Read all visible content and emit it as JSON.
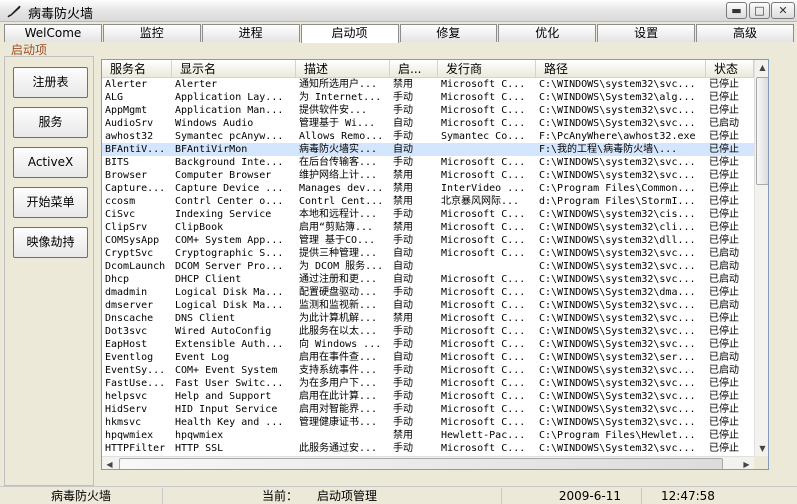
{
  "window": {
    "title": "病毒防火墙"
  },
  "tabs": [
    "WelCome",
    "监控",
    "进程",
    "启动项",
    "修复",
    "优化",
    "设置",
    "高级"
  ],
  "active_tab": 3,
  "section_label": "启动项",
  "side_buttons": [
    "注册表",
    "服务",
    "ActiveX",
    "开始菜单",
    "映像劫持"
  ],
  "columns": [
    "服务名",
    "显示名",
    "描述",
    "启...",
    "发行商",
    "路径",
    "状态"
  ],
  "selected_row": 5,
  "rows": [
    [
      "Alerter",
      "Alerter",
      "通知所选用户...",
      "禁用",
      "Microsoft C...",
      "C:\\WINDOWS\\system32\\svc...",
      "已停止"
    ],
    [
      "ALG",
      "Application Lay...",
      "为 Internet...",
      "手动",
      "Microsoft C...",
      "C:\\WINDOWS\\System32\\alg...",
      "已停止"
    ],
    [
      "AppMgmt",
      "Application Man...",
      "提供软件安...",
      "手动",
      "Microsoft C...",
      "C:\\WINDOWS\\system32\\svc...",
      "已停止"
    ],
    [
      "AudioSrv",
      "Windows Audio",
      "管理基于 Wi...",
      "自动",
      "Microsoft C...",
      "C:\\WINDOWS\\System32\\svc...",
      "已启动"
    ],
    [
      "awhost32",
      "Symantec pcAnyw...",
      "Allows Remo...",
      "手动",
      "Symantec Co...",
      "F:\\PcAnyWhere\\awhost32.exe",
      "已停止"
    ],
    [
      "BFAntiV...",
      "BFAntiVirMon",
      "病毒防火墙实...",
      "自动",
      "",
      "F:\\我的工程\\病毒防火墙\\...",
      "已停止"
    ],
    [
      "BITS",
      "Background Inte...",
      "在后台传输客...",
      "手动",
      "Microsoft C...",
      "C:\\WINDOWS\\system32\\svc...",
      "已停止"
    ],
    [
      "Browser",
      "Computer Browser",
      "维护网络上计...",
      "禁用",
      "Microsoft C...",
      "C:\\WINDOWS\\system32\\svc...",
      "已停止"
    ],
    [
      "Capture...",
      "Capture Device ...",
      "Manages dev...",
      "禁用",
      "InterVideo ...",
      "C:\\Program Files\\Common...",
      "已停止"
    ],
    [
      "ccosm",
      "Contrl Center o...",
      "Contrl Cent...",
      "禁用",
      "北京暴风网际...",
      "d:\\Program Files\\StormI...",
      "已停止"
    ],
    [
      "CiSvc",
      "Indexing Service",
      "本地和远程计...",
      "手动",
      "Microsoft C...",
      "C:\\WINDOWS\\system32\\cis...",
      "已停止"
    ],
    [
      "ClipSrv",
      "ClipBook",
      "启用“剪贴簿...",
      "禁用",
      "Microsoft C...",
      "C:\\WINDOWS\\system32\\cli...",
      "已停止"
    ],
    [
      "COMSysApp",
      "COM+ System App...",
      "管理 基于CO...",
      "手动",
      "Microsoft C...",
      "C:\\WINDOWS\\system32\\dll...",
      "已停止"
    ],
    [
      "CryptSvc",
      "Cryptographic S...",
      "提供三种管理...",
      "自动",
      "Microsoft C...",
      "C:\\WINDOWS\\system32\\svc...",
      "已启动"
    ],
    [
      "DcomLaunch",
      "DCOM Server Pro...",
      "为 DCOM 服务...",
      "自动",
      "",
      "C:\\WINDOWS\\system32\\svc...",
      "已启动"
    ],
    [
      "Dhcp",
      "DHCP Client",
      "通过注册和更...",
      "自动",
      "Microsoft C...",
      "C:\\WINDOWS\\system32\\svc...",
      "已启动"
    ],
    [
      "dmadmin",
      "Logical Disk Ma...",
      "配置硬盘驱动...",
      "手动",
      "Microsoft C...",
      "C:\\WINDOWS\\System32\\dma...",
      "已停止"
    ],
    [
      "dmserver",
      "Logical Disk Ma...",
      "监测和监视新...",
      "自动",
      "Microsoft C...",
      "C:\\WINDOWS\\System32\\svc...",
      "已启动"
    ],
    [
      "Dnscache",
      "DNS Client",
      "为此计算机解...",
      "禁用",
      "Microsoft C...",
      "C:\\WINDOWS\\system32\\svc...",
      "已停止"
    ],
    [
      "Dot3svc",
      "Wired AutoConfig",
      "此服务在以太...",
      "手动",
      "Microsoft C...",
      "C:\\WINDOWS\\System32\\svc...",
      "已停止"
    ],
    [
      "EapHost",
      "Extensible Auth...",
      "向 Windows ...",
      "手动",
      "Microsoft C...",
      "C:\\WINDOWS\\System32\\svc...",
      "已停止"
    ],
    [
      "Eventlog",
      "Event Log",
      "启用在事件查...",
      "自动",
      "Microsoft C...",
      "C:\\WINDOWS\\system32\\ser...",
      "已启动"
    ],
    [
      "EventSy...",
      "COM+ Event System",
      "支持系统事件...",
      "手动",
      "Microsoft C...",
      "C:\\WINDOWS\\system32\\svc...",
      "已启动"
    ],
    [
      "FastUse...",
      "Fast User Switc...",
      "为在多用户下...",
      "手动",
      "Microsoft C...",
      "C:\\WINDOWS\\system32\\svc...",
      "已停止"
    ],
    [
      "helpsvc",
      "Help and Support",
      "启用在此计算...",
      "手动",
      "Microsoft C...",
      "C:\\WINDOWS\\System32\\svc...",
      "已停止"
    ],
    [
      "HidServ",
      "HID Input Service",
      "启用对智能界...",
      "手动",
      "Microsoft C...",
      "C:\\WINDOWS\\System32\\svc...",
      "已停止"
    ],
    [
      "hkmsvc",
      "Health Key and ...",
      "管理健康证书...",
      "手动",
      "Microsoft C...",
      "C:\\WINDOWS\\System32\\svc...",
      "已停止"
    ],
    [
      "hpqwmiex",
      "hpqwmiex",
      "",
      "禁用",
      "Hewlett-Pac...",
      "C:\\Program Files\\Hewlet...",
      "已停止"
    ],
    [
      "HTTPFilter",
      "HTTP SSL",
      "此服务通过安...",
      "手动",
      "Microsoft C...",
      "C:\\WINDOWS\\System32\\svc...",
      "已停止"
    ]
  ],
  "status": {
    "app": "病毒防火墙",
    "current_label": "当前：",
    "current_value": "启动项管理",
    "date": "2009-6-11",
    "time": "12:47:58"
  }
}
